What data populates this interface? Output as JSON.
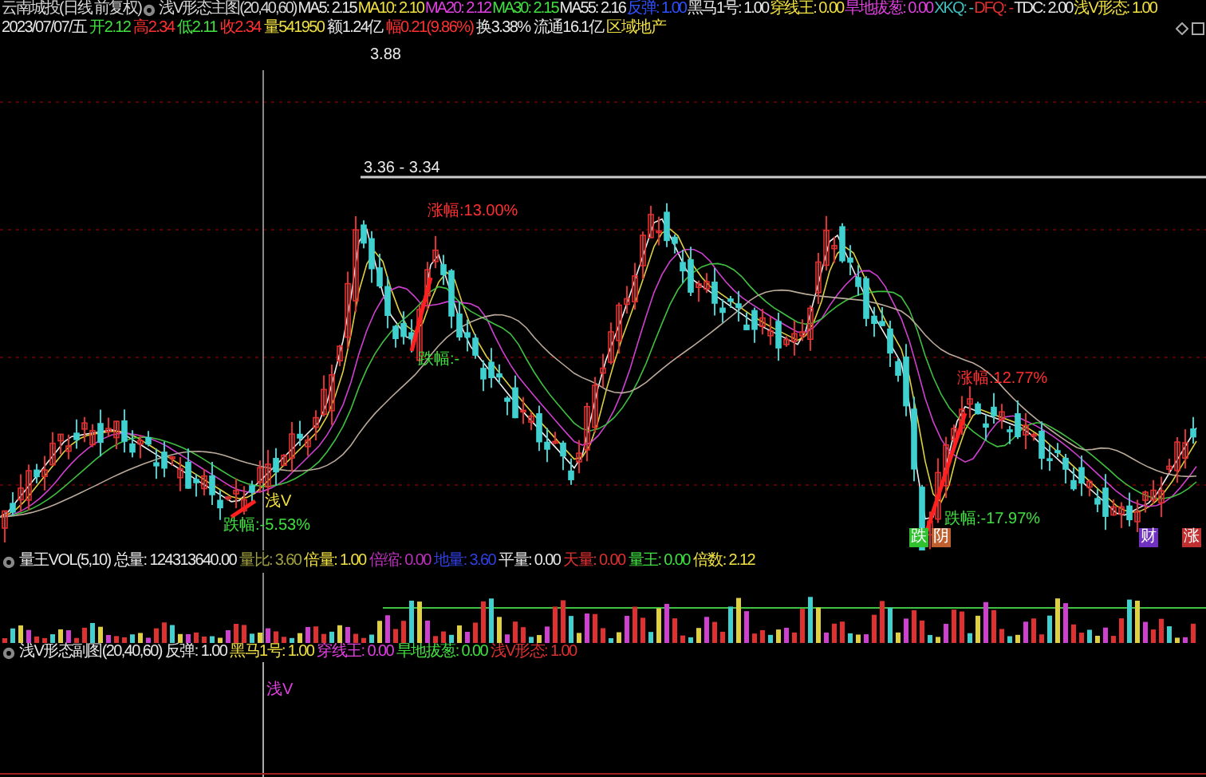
{
  "main_header": [
    {
      "text": "云南城投(日线 前复权)",
      "color": "#d8d8d8"
    },
    {
      "text": "浅V形态主图(20,40,60)",
      "color": "#d8d8d8",
      "kind": "indicator"
    },
    {
      "text": "MA5: 2.15",
      "color": "#e8e8e8"
    },
    {
      "text": "MA10: 2.10",
      "color": "#f0e040"
    },
    {
      "text": "MA20: 2.12",
      "color": "#e040e0"
    },
    {
      "text": "MA30: 2.15",
      "color": "#40e040"
    },
    {
      "text": "MA55: 2.16",
      "color": "#e8e8e8"
    },
    {
      "text": "反弹: 1.00",
      "color": "#3050ff"
    },
    {
      "text": "黑马1号: 1.00",
      "color": "#e8e8e8"
    },
    {
      "text": "穿线王: 0.00",
      "color": "#f0e040"
    },
    {
      "text": "旱地拔葱: 0.00",
      "color": "#e040e0"
    },
    {
      "text": "XKQ: -",
      "color": "#40c0c0"
    },
    {
      "text": "DFQ: -",
      "color": "#e03030"
    },
    {
      "text": "TDC: 2.00",
      "color": "#e8e8e8"
    },
    {
      "text": "浅V形态: 1.00",
      "color": "#f0e040"
    }
  ],
  "quote_line": [
    {
      "text": "2023/07/07/五",
      "color": "#e8e8e8"
    },
    {
      "text": "开2.12",
      "color": "#40e040"
    },
    {
      "text": "高2.34",
      "color": "#ff3030"
    },
    {
      "text": "低2.11",
      "color": "#40e040"
    },
    {
      "text": "收2.34",
      "color": "#ff3030"
    },
    {
      "text": "量541950",
      "color": "#f0e040"
    },
    {
      "text": "额1.24亿",
      "color": "#e8e8e8"
    },
    {
      "text": "幅0.21(9.86%)",
      "color": "#ff3030"
    },
    {
      "text": "换3.38%",
      "color": "#e8e8e8"
    },
    {
      "text": "流通16.1亿",
      "color": "#e8e8e8"
    },
    {
      "text": "区域地产",
      "color": "#f0e040"
    }
  ],
  "main_chart": {
    "labels": [
      {
        "text": "3.88",
        "color": "#e8e8e8",
        "kind": "price"
      },
      {
        "text": "3.36 - 3.34",
        "color": "#e8e8e8",
        "kind": "price"
      },
      {
        "text": "涨幅:13.00%",
        "color": "#ff3030",
        "kind": "note"
      },
      {
        "text": "跌幅:-",
        "color": "#40e040",
        "kind": "note"
      },
      {
        "text": "跌幅:-5.53%",
        "color": "#40e040",
        "kind": "note"
      },
      {
        "text": "浅V",
        "color": "#f0e040",
        "kind": "note"
      },
      {
        "text": "涨幅:12.77%",
        "color": "#ff3030",
        "kind": "note"
      },
      {
        "text": "跌幅:-17.97%",
        "color": "#40e040",
        "kind": "note"
      },
      {
        "text": "跌",
        "color": "#30c030",
        "kind": "tag"
      },
      {
        "text": "阴",
        "color": "#c06030",
        "kind": "tag"
      },
      {
        "text": "财",
        "color": "#7030c0",
        "kind": "tag"
      },
      {
        "text": "涨",
        "color": "#c03030",
        "kind": "tag"
      }
    ]
  },
  "volume_header": [
    {
      "text": "量王VOL(5,10)",
      "color": "#e8e8e8",
      "kind": "indicator"
    },
    {
      "text": "总量: 124313640.00",
      "color": "#e8e8e8"
    },
    {
      "text": "量比: 3.60",
      "color": "#a0a040"
    },
    {
      "text": "倍量: 1.00",
      "color": "#f0e040"
    },
    {
      "text": "倍缩: 0.00",
      "color": "#c030c0"
    },
    {
      "text": "地量: 3.60",
      "color": "#3040e0"
    },
    {
      "text": "平量: 0.00",
      "color": "#e8e8e8"
    },
    {
      "text": "天量: 0.00",
      "color": "#e03030"
    },
    {
      "text": "量王: 0.00",
      "color": "#40e040"
    },
    {
      "text": "倍数: 2.12",
      "color": "#f0e040"
    }
  ],
  "sub_header": [
    {
      "text": "浅V形态副图(20,40,60)",
      "color": "#e8e8e8",
      "kind": "indicator"
    },
    {
      "text": "反弹: 1.00",
      "color": "#e8e8e8"
    },
    {
      "text": "黑马1号: 1.00",
      "color": "#f0e040"
    },
    {
      "text": "穿线王: 0.00",
      "color": "#e040e0"
    },
    {
      "text": "旱地拔葱: 0.00",
      "color": "#40e040"
    },
    {
      "text": "浅V形态: 1.00",
      "color": "#e03030"
    }
  ],
  "sub_chart": {
    "labels": [
      {
        "text": "浅V",
        "color": "#e040e0"
      }
    ]
  }
}
